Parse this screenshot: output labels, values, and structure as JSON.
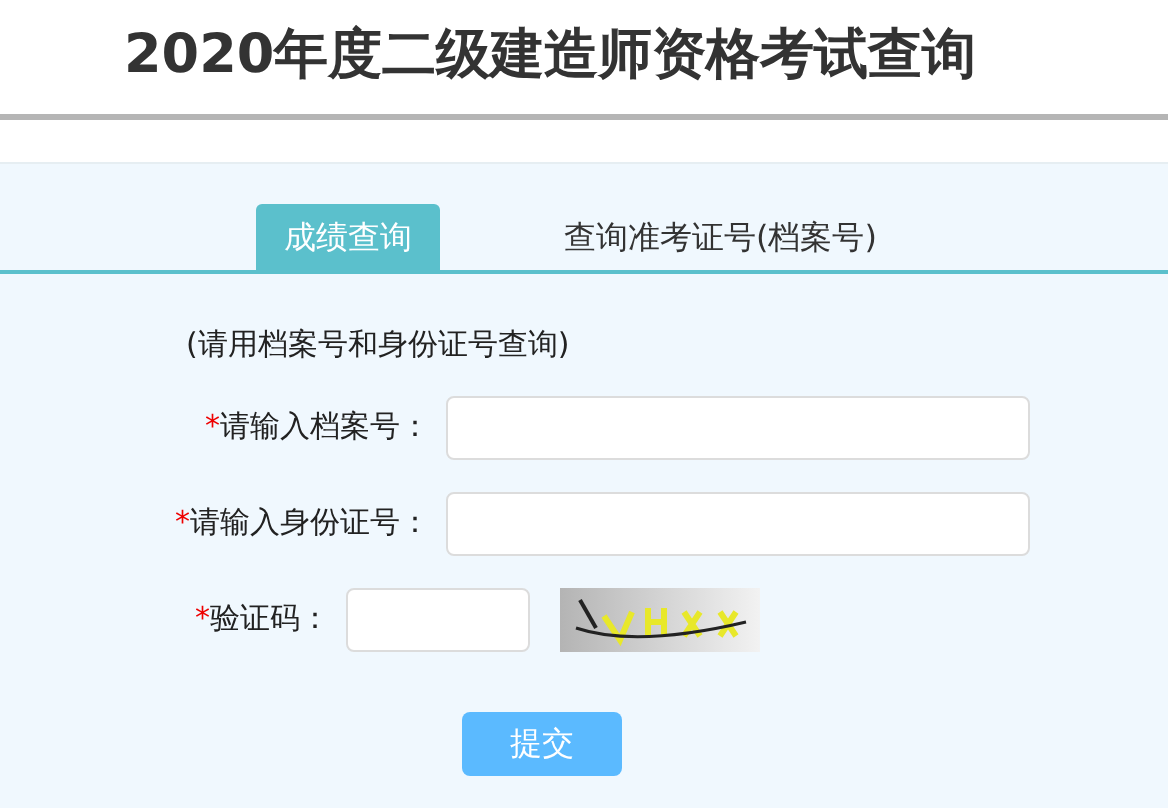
{
  "header": {
    "title": "2020年度二级建造师资格考试查询"
  },
  "tabs": [
    {
      "label": "成绩查询",
      "selected": true
    },
    {
      "label": "查询准考证号(档案号)",
      "selected": false
    }
  ],
  "hint": "(请用档案号和身份证号查询)",
  "fields": [
    {
      "kind": "text",
      "required_mark": "*",
      "label": "请输入档案号："
    },
    {
      "kind": "text",
      "required_mark": "*",
      "label": "请输入身份证号："
    },
    {
      "kind": "captcha",
      "required_mark": "*",
      "label": "验证码："
    }
  ],
  "submit": "提交"
}
